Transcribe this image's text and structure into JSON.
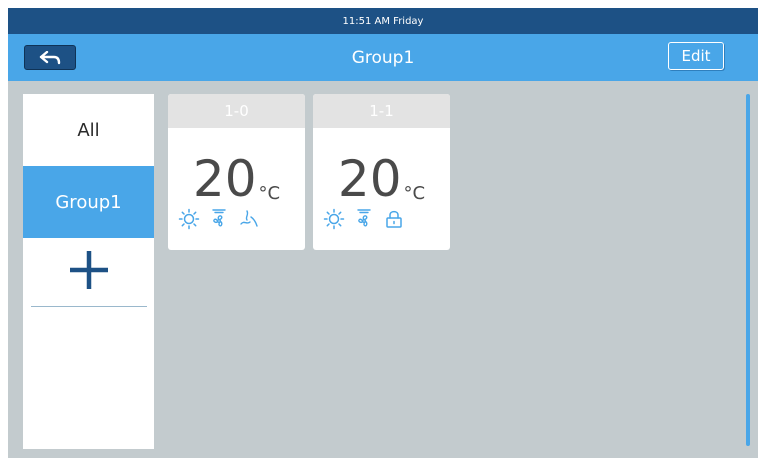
{
  "status": {
    "time": "11:51 AM",
    "day": "Friday"
  },
  "header": {
    "title": "Group1",
    "edit_label": "Edit"
  },
  "sidebar": {
    "items": [
      {
        "label": "All"
      },
      {
        "label": "Group1"
      }
    ]
  },
  "cards": [
    {
      "id": "1-0",
      "temperature": "20",
      "unit": "°C",
      "icons": [
        "sun-icon",
        "fan-icon",
        "swing-icon"
      ]
    },
    {
      "id": "1-1",
      "temperature": "20",
      "unit": "°C",
      "icons": [
        "sun-icon",
        "fan-icon",
        "lock-icon"
      ]
    }
  ],
  "colors": {
    "statusbar": "#1d5185",
    "accent": "#49a6e8",
    "background": "#c3cbce",
    "icon": "#49a6e8"
  }
}
